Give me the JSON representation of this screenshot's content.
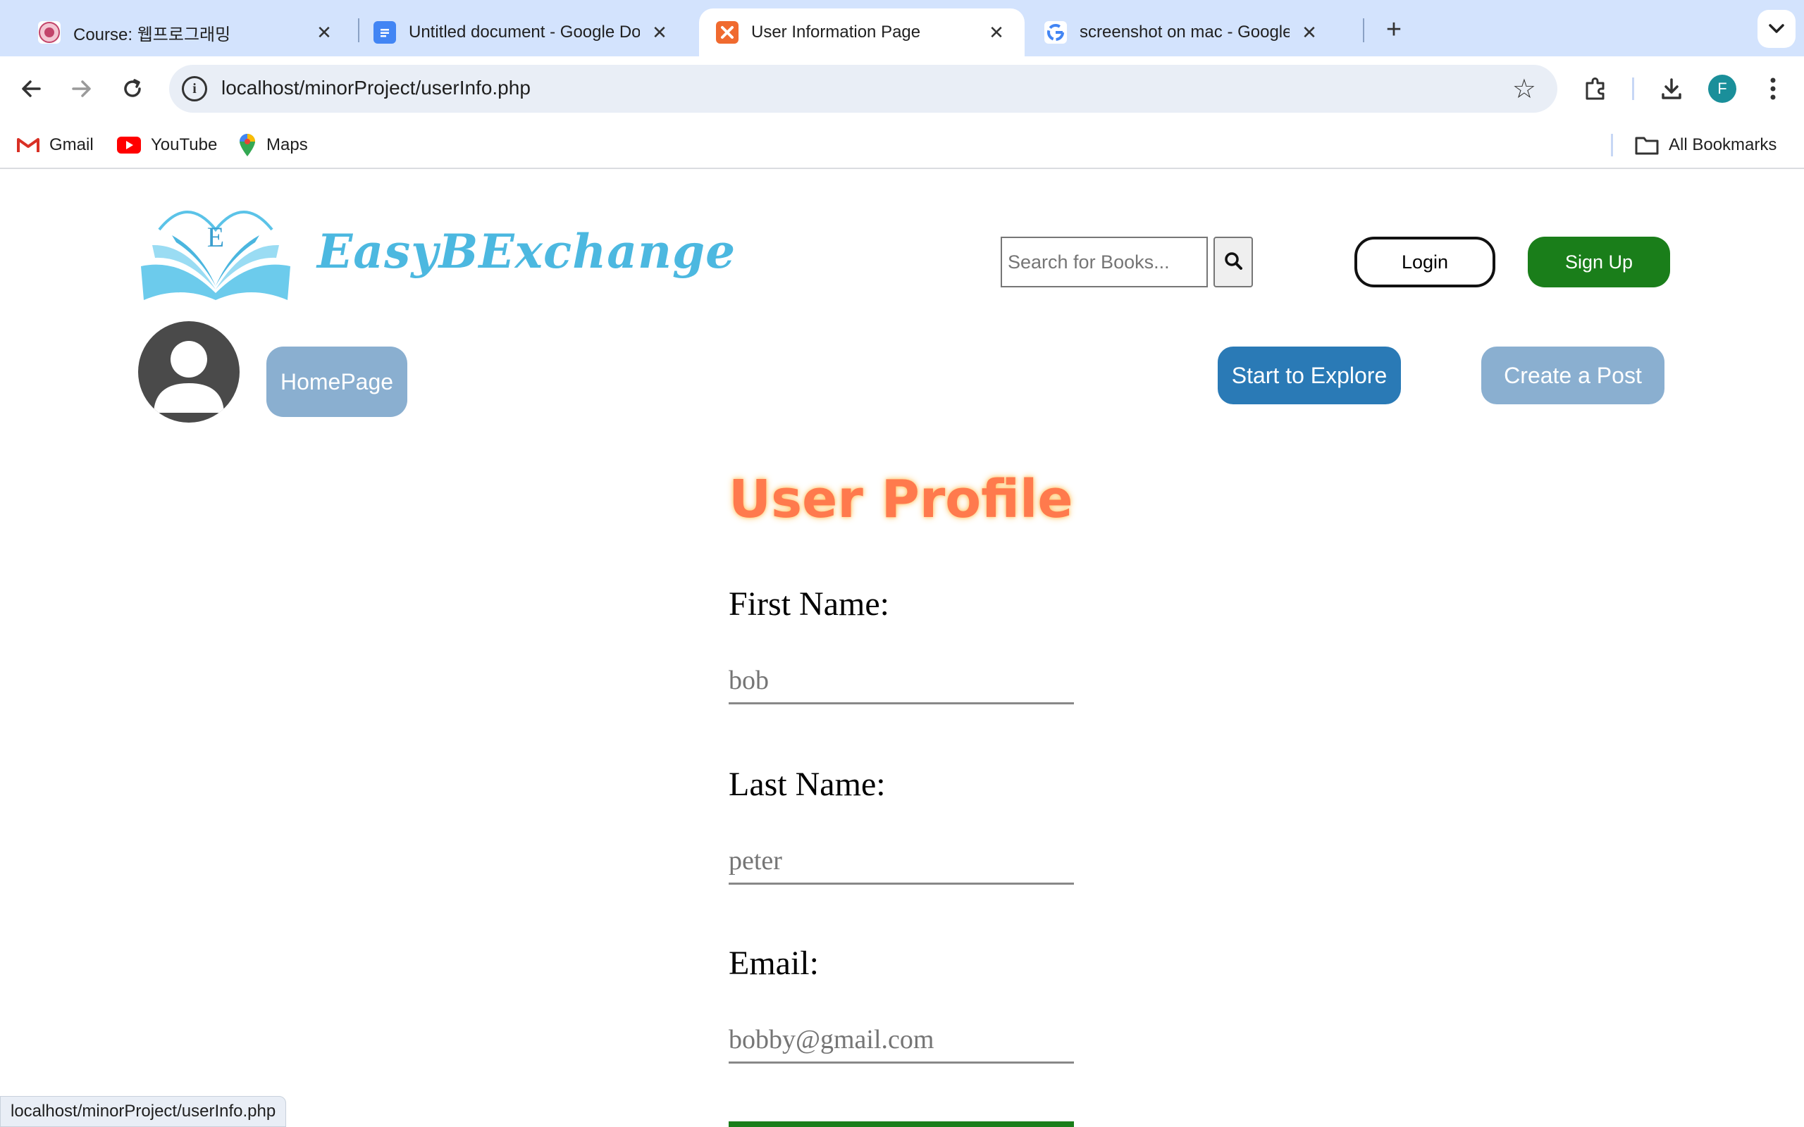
{
  "browser": {
    "tabs": [
      {
        "title": "Course: 웹프로그래밍",
        "favicon": "course-seal-icon",
        "active": false
      },
      {
        "title": "Untitled document - Google Docs",
        "favicon": "google-docs-icon",
        "active": false
      },
      {
        "title": "User Information Page",
        "favicon": "xampp-icon",
        "active": true
      },
      {
        "title": "screenshot on mac - Google Search",
        "favicon": "google-g-icon",
        "active": false
      }
    ],
    "url": "localhost/minorProject/userInfo.php",
    "profile_initial": "F",
    "bookmarks": [
      {
        "label": "Gmail",
        "icon": "gmail-icon"
      },
      {
        "label": "YouTube",
        "icon": "youtube-icon"
      },
      {
        "label": "Maps",
        "icon": "maps-icon"
      }
    ],
    "all_bookmarks_label": "All Bookmarks",
    "status_url": "localhost/minorProject/userInfo.php"
  },
  "site": {
    "brand": "EasyBExchange",
    "logo_letter": "E",
    "search_placeholder": "Search for Books...",
    "login_label": "Login",
    "signup_label": "Sign Up",
    "homepage_label": "HomePage",
    "explore_label": "Start to Explore",
    "create_post_label": "Create a Post"
  },
  "profile": {
    "title": "User Profile",
    "fields": [
      {
        "label": "First Name:",
        "value": "bob"
      },
      {
        "label": "Last Name:",
        "value": "peter"
      },
      {
        "label": "Email:",
        "value": "bobby@gmail.com"
      }
    ]
  },
  "colors": {
    "tabstrip": "#d3e3fd",
    "brand": "#4cb8e0",
    "signup": "#1a7e1a",
    "explore": "#2a7ab6",
    "muted_button": "#8aafd0",
    "title": "#ff7a4d"
  }
}
